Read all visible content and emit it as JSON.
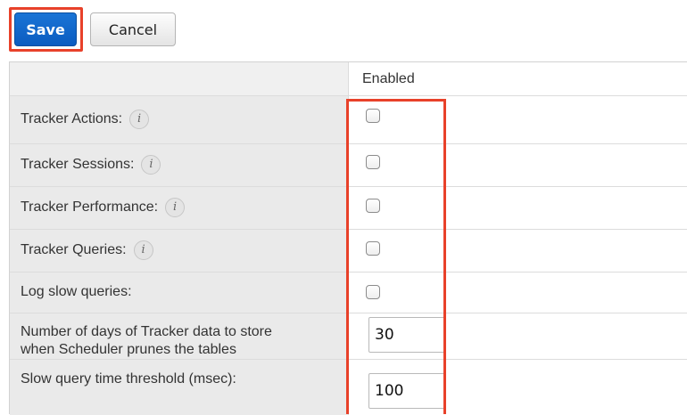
{
  "toolbar": {
    "save_label": "Save",
    "cancel_label": "Cancel"
  },
  "table": {
    "enabled_header": "Enabled",
    "rows": [
      {
        "label": "Tracker Actions:",
        "has_info": true,
        "control": "checkbox",
        "checked": false
      },
      {
        "label": "Tracker Sessions:",
        "has_info": true,
        "control": "checkbox",
        "checked": false
      },
      {
        "label": "Tracker Performance:",
        "has_info": true,
        "control": "checkbox",
        "checked": false
      },
      {
        "label": "Tracker Queries:",
        "has_info": true,
        "control": "checkbox",
        "checked": false
      },
      {
        "label": "Log slow queries:",
        "has_info": false,
        "control": "checkbox",
        "checked": false
      },
      {
        "label_line1": "Number of days of Tracker data to store",
        "label_line2": "when Scheduler prunes the tables",
        "control": "text",
        "value": "30"
      },
      {
        "label": "Slow query time threshold (msec):",
        "control": "text",
        "value": "100"
      }
    ]
  },
  "info_icon_glyph": "i",
  "icons": {
    "info": "info-icon"
  },
  "colors": {
    "save_button": "#0b5cc0",
    "highlight": "#e8412a",
    "label_column": "#eaeaea"
  }
}
